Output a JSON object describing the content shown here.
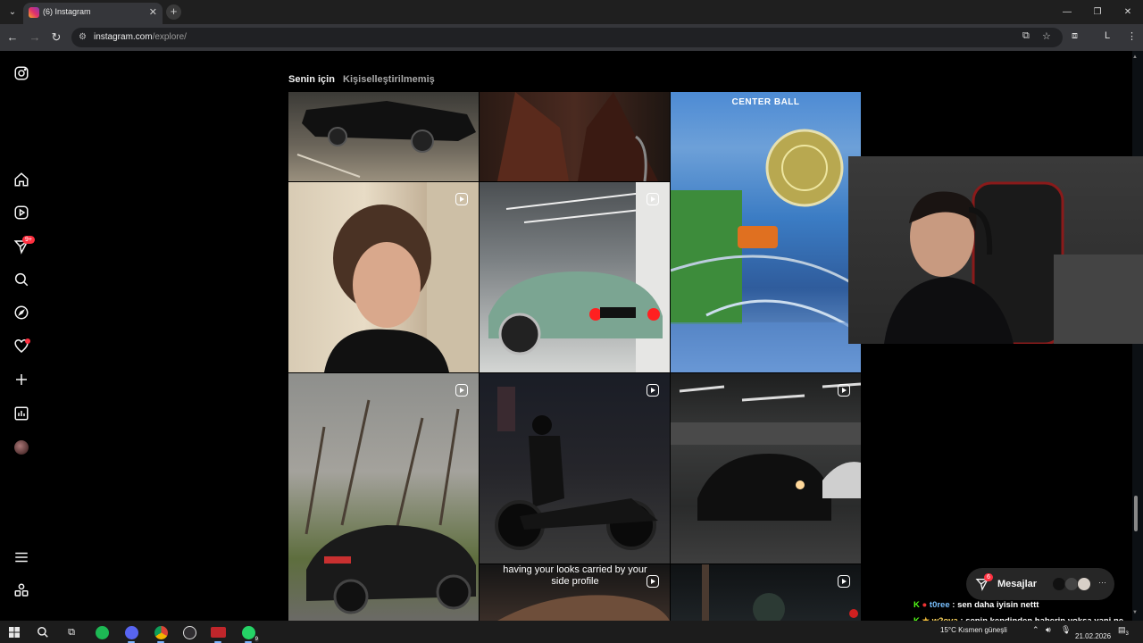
{
  "browser": {
    "tab_title": "(6) Instagram",
    "url_host": "instagram.com",
    "url_path": "/explore/"
  },
  "sidebar": {
    "notifications_badge": "9+",
    "icons": [
      "instagram-logo-icon",
      "home-icon",
      "reels-icon",
      "messages-icon",
      "search-icon",
      "explore-icon",
      "notifications-icon",
      "create-icon",
      "dashboard-icon",
      "profile-avatar",
      "menu-icon",
      "also-from-meta-icon"
    ]
  },
  "explore": {
    "tabs": [
      {
        "label": "Senin için",
        "active": true
      },
      {
        "label": "Kişiselleştirilmemiş",
        "active": false
      }
    ],
    "posts": [
      {
        "kind": "image",
        "desc": "black-muscle-car"
      },
      {
        "kind": "image",
        "desc": "leather-jacket"
      },
      {
        "kind": "image",
        "desc": "rocket-league",
        "overlay_text": "CENTER BALL"
      },
      {
        "kind": "reel",
        "desc": "portrait-man"
      },
      {
        "kind": "reel",
        "desc": "green-gt-car"
      },
      {
        "kind": "reel",
        "desc": "bmw-coupe"
      },
      {
        "kind": "reel",
        "desc": "motorcycle-night"
      },
      {
        "kind": "reel",
        "desc": "car-garage-night"
      },
      {
        "kind": "reel",
        "desc": "side-profile",
        "caption": "having your looks carried by your side profile"
      },
      {
        "kind": "reel",
        "desc": "night-scene"
      }
    ]
  },
  "messages": {
    "label": "Mesajlar",
    "badge": "6"
  },
  "chat": [
    {
      "user": "t0ree",
      "text": "sen daha iyisin nettt"
    },
    {
      "user": "w2ova",
      "text": "senin kendinden haberin yoksa yani ne diyelim artık"
    }
  ],
  "taskbar": {
    "whatsapp_badge": "9",
    "weather": "15°C  Kısmen güneşli",
    "date": "21.02.2026",
    "notif_count": "3"
  },
  "colors": {
    "accent_badge": "#ff3040",
    "background": "#000000"
  }
}
